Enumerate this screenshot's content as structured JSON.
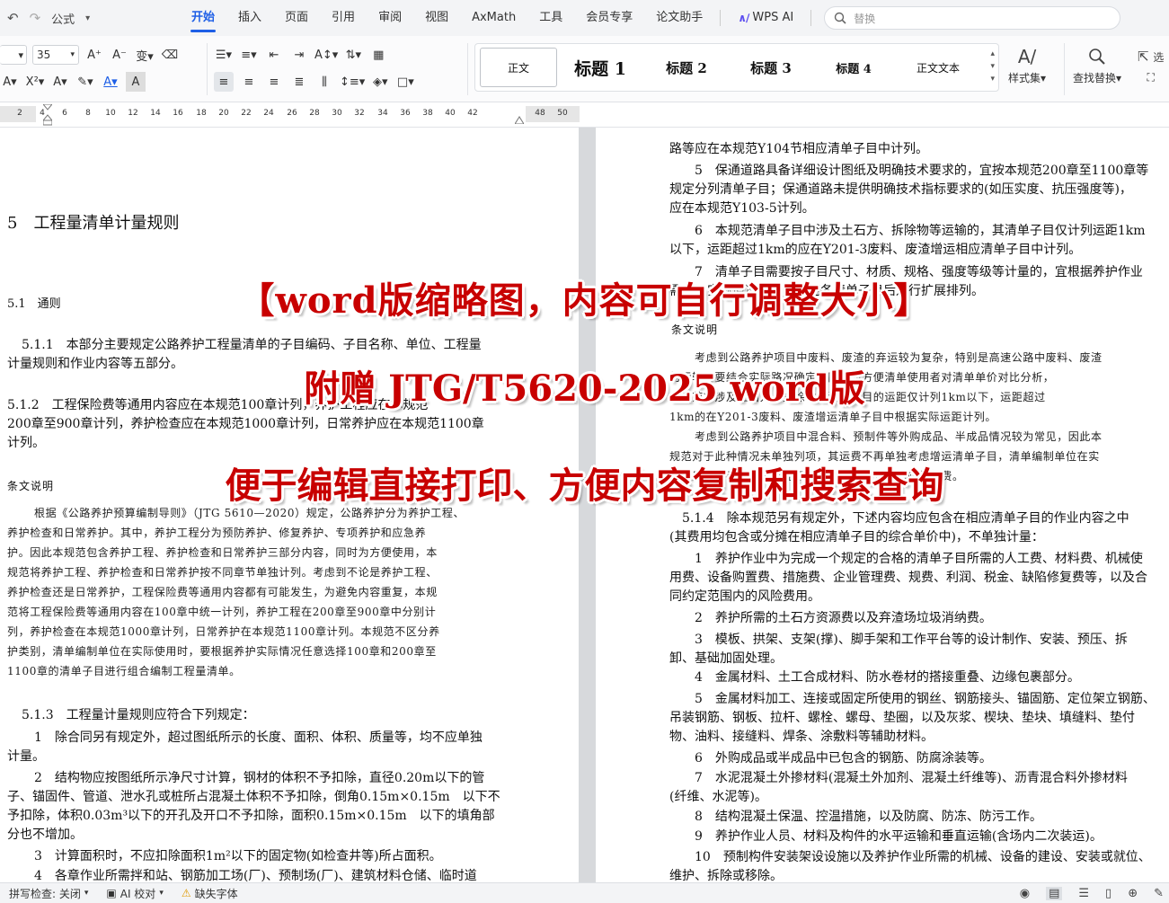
{
  "menubar": {
    "undo_icon": "undo-icon",
    "style_label": "公式",
    "tabs": [
      "开始",
      "插入",
      "页面",
      "引用",
      "审阅",
      "视图",
      "AxMath",
      "工具",
      "会员专享",
      "论文助手"
    ],
    "ai_label": "WPS AI",
    "search_placeholder": "替换"
  },
  "toolbar": {
    "font_size": "35",
    "styles": [
      "正文",
      "标题 1",
      "标题 2",
      "标题 3",
      "标题 4",
      "正文文本"
    ],
    "style_set_label": "样式集",
    "find_replace_label": "查找替换",
    "select_label": "选"
  },
  "ruler": {
    "ticks": [
      "2",
      "4",
      "6",
      "8",
      "10",
      "12",
      "14",
      "16",
      "18",
      "20",
      "22",
      "24",
      "26",
      "28",
      "30",
      "32",
      "34",
      "36",
      "38",
      "40",
      "42",
      "48",
      "50"
    ]
  },
  "left_page": {
    "chapter": "5　工程量清单计量规则",
    "section": "5.1　通则",
    "lines": [
      "5.1.1　本部分主要规定公路养护工程量清单的子目编码、子目名称、单位、工程量",
      "计量规则和作业内容等五部分。",
      "5.1.2　工程保险费等通用内容应在本规范100章计列，养护工程应在本规范",
      "200章至900章计列，养护检查应在本规范1000章计列，日常养护应在本规范1100章",
      "计列。"
    ],
    "note_heading": "条文说明",
    "note_lines": [
      "根据《公路养护预算编制导则》（JTG 5610—2020）规定，公路养护分为养护工程、",
      "养护检查和日常养护。其中，养护工程分为预防养护、修复养护、专项养护和应急养",
      "护。因此本规范包含养护工程、养护检查和日常养护三部分内容，同时为方便使用，本",
      "规范将养护工程、养护检查和日常养护按不同章节单独计列。考虑到不论是养护工程、",
      "养护检查还是日常养护，工程保险费等通用内容都有可能发生，为避免内容重复，本规",
      "范将工程保险费等通用内容在100章中统一计列，养护工程在200章至900章中分别计",
      "列，养护检查在本规范1000章计列，日常养护在本规范1100章计列。本规范不区分养",
      "护类别，清单编制单位在实际使用时，要根据养护实际情况任意选择100章和200章至",
      "1100章的清单子目进行组合编制工程量清单。"
    ],
    "lines2": [
      "5.1.3　工程量计量规则应符合下列规定：",
      "1　除合同另有规定外，超过图纸所示的长度、面积、体积、质量等，均不应单独",
      "计量。",
      "2　结构物应按图纸所示净尺寸计算，钢材的体积不予扣除，直径0.20m以下的管",
      "子、锚固件、管道、泄水孔或桩所占混凝土体积不予扣除，倒角0.15m×0.15m　以下不",
      "予扣除，体积0.03m³以下的开孔及开口不予扣除，面积0.15m×0.15m　以下的填角部",
      "分也不增加。",
      "3　计算面积时，不应扣除面积1m²以下的固定物(如检查井等)所占面积。",
      "4　各章作业所需拌和站、钢筋加工场(厂)、预制场(厂)、建筑材料仓储、临时道"
    ]
  },
  "right_page": {
    "lines": [
      "路等应在本规范Y104节相应清单子目中计列。",
      "5　保通道路具备详细设计图纸及明确技术要求的，宜按本规范200章至1100章等",
      "规定分列清单子目；保通道路未提供明确技术指标要求的(如压实度、抗压强度等)，",
      "应在本规范Y103-5计列。",
      "6　本规范清单子目中涉及土石方、拆除物等运输的，其清单子目仅计列运距1km",
      "以下，运距超过1km的应在Y201-3废料、废渣增运相应清单子目中计列。",
      "7　清单子目需要按子目尺寸、材质、规格、强度等级等计量的，宜根据养护作业",
      "需求及实际情况，在本规范各清单子目后进行扩展排列。"
    ],
    "note_heading": "条文说明",
    "note_lines": [
      "考虑到公路养护项目中废料、废渣的弃运较为复杂，特别是高速公路中废料、废渣",
      "的运输需要结合实际路况确定，同时为方便清单使用者对清单单价对比分析，",
      "本规范将涉及土石方、拆除物等清单子目的运距仅计列1km以下，运距超过",
      "1km的在Y201-3废料、废渣增运清单子目中根据实际运距计列。",
      "考虑到公路养护项目中混合料、预制件等外购成品、半成品情况较为常见，因此本",
      "规范对于此种情况未单独列项，其运费不再单独考虑增运清单子目，清单编制单位在实",
      "际使用时，可根据需要在相应清单子目中考虑相应的运费。"
    ],
    "lines2": [
      "5.1.4　除本规范另有规定外，下述内容均应包含在相应清单子目的作业内容之中",
      "(其费用均包含或分摊在相应清单子目的综合单价中)，不单独计量：",
      "1　养护作业中为完成一个规定的合格的清单子目所需的人工费、材料费、机械使",
      "用费、设备购置费、措施费、企业管理费、规费、利润、税金、缺陷修复费等，以及合",
      "同约定范围内的风险费用。",
      "2　养护所需的土石方资源费以及弃渣场垃圾消纳费。",
      "3　模板、拱架、支架(撑)、脚手架和工作平台等的设计制作、安装、预压、拆",
      "卸、基础加固处理。",
      "4　金属材料、土工合成材料、防水卷材的搭接重叠、边缘包裹部分。",
      "5　金属材料加工、连接或固定所使用的钢丝、钢筋接头、锚固筋、定位架立钢筋、",
      "吊装钢筋、钢板、拉杆、螺栓、螺母、垫圈，以及灰浆、楔块、垫块、填缝料、垫付",
      "物、油料、接缝料、焊条、涂敷料等辅助材料。",
      "6　外购成品或半成品中已包含的钢筋、防腐涂装等。",
      "7　水泥混凝土外掺材料(混凝土外加剂、混凝土纤维等)、沥青混合料外掺材料",
      "(纤维、水泥等)。",
      "8　结构混凝土保温、控温措施，以及防腐、防冻、防污工作。",
      "9　养护作业人员、材料及构件的水平运输和垂直运输(含场内二次装运)。",
      "10　预制构件安装架设设施以及养护作业所需的机械、设备的建设、安装或就位、",
      "维护、拆除或移除。"
    ]
  },
  "overlay": {
    "line1": "【word版缩略图，内容可自行调整大小】",
    "line2": "附赠 JTG/T5620-2025 word版",
    "line3": "便于编辑直接打印、方便内容复制和搜索查询"
  },
  "statusbar": {
    "spellcheck": "拼写检查: 关闭",
    "ai_check": "AI 校对",
    "missing_font": "缺失字体"
  },
  "colors": {
    "accent": "#1e5fe6",
    "overlay_red": "#c80000"
  }
}
